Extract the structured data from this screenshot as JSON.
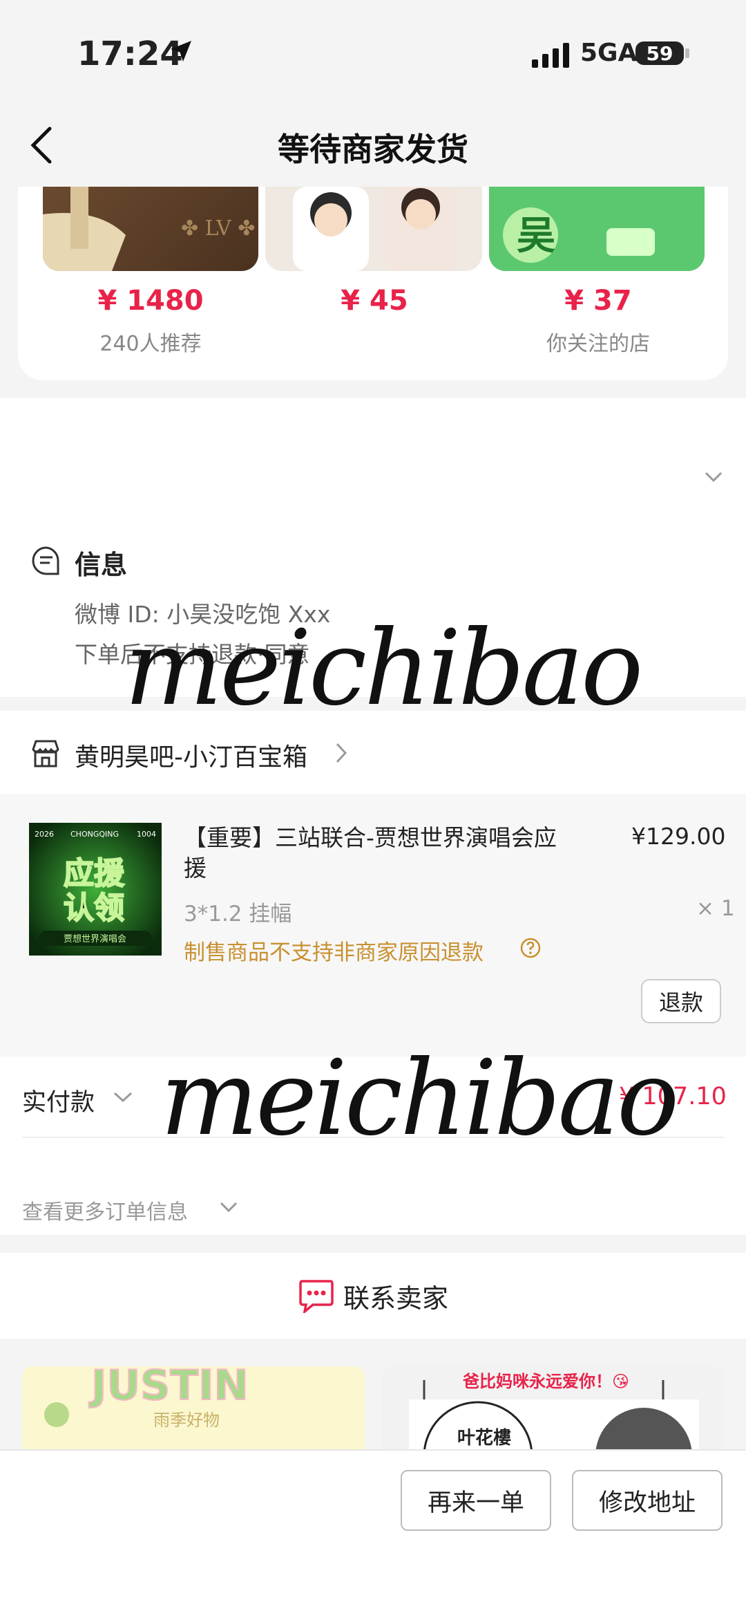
{
  "status_bar": {
    "time": "17:24",
    "network": "5GA",
    "battery": "59"
  },
  "nav": {
    "title": "等待商家发货"
  },
  "recommend": {
    "items": [
      {
        "price": "¥ 1480",
        "sub": "240人推荐"
      },
      {
        "price": "¥ 45",
        "sub": ""
      },
      {
        "price": "¥ 37",
        "sub": "你关注的店"
      }
    ],
    "thumb3_text": "吴"
  },
  "info": {
    "title": "信息",
    "line1": "微博 ID: 小昊没吃饱 Xxx",
    "line2": "下单后不支持退款·同意"
  },
  "shop": {
    "name": "黄明昊吧-小汀百宝箱"
  },
  "product": {
    "title": "【重要】三站联合-贾想世界演唱会应援",
    "price": "¥129.00",
    "spec": "3*1.2 挂幅",
    "qty": "× 1",
    "warning": "制售商品不支持非商家原因退款",
    "refund_label": "退款",
    "thumb": {
      "top_left": "2026",
      "top_mid": "CHONGQING",
      "top_right": "1004",
      "line1": "应援",
      "line2": "认领",
      "footer": "贾想世界演唱会"
    }
  },
  "payment": {
    "label": "实付款",
    "amount": "¥ 107.10",
    "more": "查看更多订单信息"
  },
  "contact": {
    "label": "联系卖家"
  },
  "banners": {
    "left_title": "JUSTIN",
    "left_sub": "雨季好物",
    "right_title": "爸比妈咪永远爱你！😘",
    "right_text": "叶花樓"
  },
  "actions": {
    "reorder": "再来一单",
    "edit_address": "修改地址"
  },
  "watermark": "meichibao",
  "colors": {
    "accent": "#e8234a",
    "warning": "#c8902f"
  }
}
